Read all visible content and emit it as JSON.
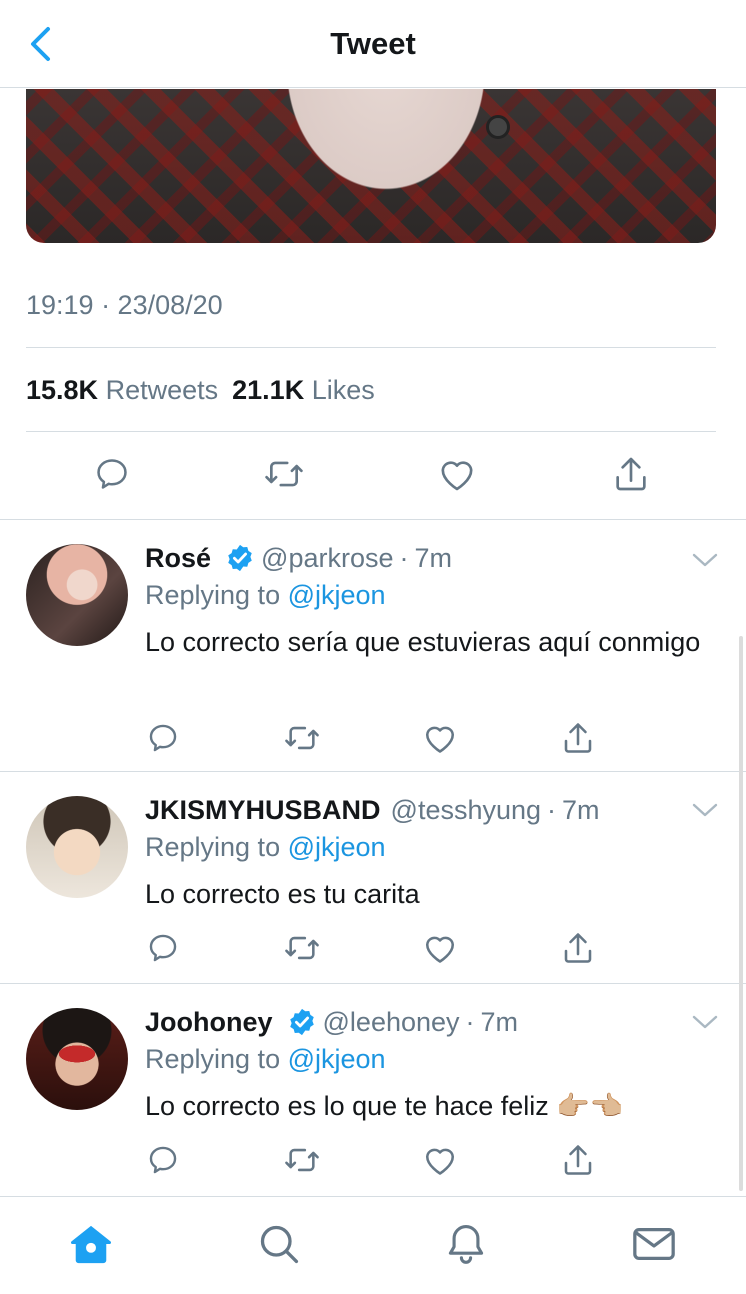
{
  "header": {
    "title": "Tweet",
    "back_icon": "chevron-left-icon"
  },
  "tweet": {
    "timestamp": "19:19 · 23/08/20",
    "retweets_count": "15.8K",
    "retweets_label": "Retweets",
    "likes_count": "21.1K",
    "likes_label": "Likes"
  },
  "replies": [
    {
      "name": "Rosé",
      "verified": true,
      "handle": "@parkrose",
      "dot": "·",
      "time": "7m",
      "replying_prefix": "Replying to",
      "replying_to": "@jkjeon",
      "text": "Lo correcto sería que estuvieras aquí conmigo"
    },
    {
      "name": "JKISMYHUSBAND",
      "verified": false,
      "handle": "@tesshyung",
      "dot": "·",
      "time": "7m",
      "replying_prefix": "Replying to",
      "replying_to": "@jkjeon",
      "text": "Lo correcto es tu carita"
    },
    {
      "name": "Joohoney",
      "verified": true,
      "handle": "@leehoney",
      "dot": "·",
      "time": "7m",
      "replying_prefix": "Replying to",
      "replying_to": "@jkjeon",
      "text": "Lo correcto es lo que te hace feliz 👉🏼👈🏼"
    }
  ],
  "tabbar": {
    "items": [
      "home-icon",
      "search-icon",
      "notifications-icon",
      "messages-icon"
    ],
    "active": "home-icon"
  },
  "colors": {
    "accent": "#1da1f2",
    "muted": "#657786",
    "text": "#14171a",
    "border": "#d6dde2"
  }
}
